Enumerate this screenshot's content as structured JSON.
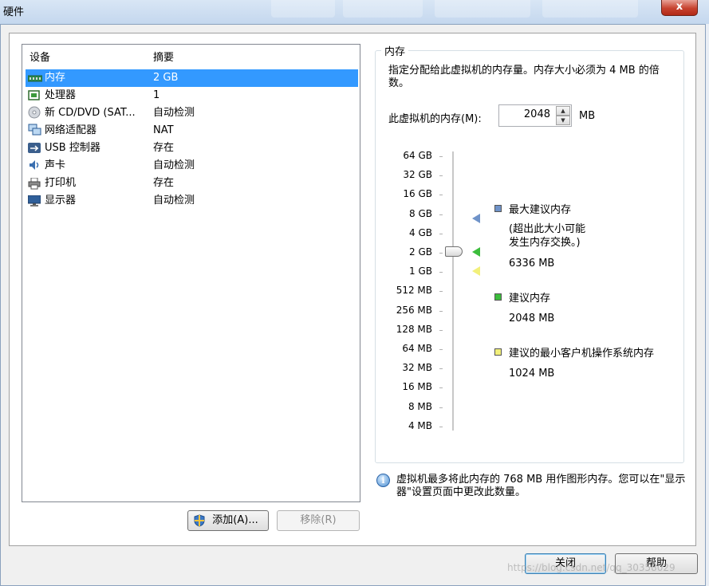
{
  "window": {
    "title": "硬件",
    "close_glyph": "x"
  },
  "devices": {
    "col_device": "设备",
    "col_summary": "摘要",
    "items": [
      {
        "name": "内存",
        "summary": "2 GB",
        "icon": "memory-icon",
        "selected": true
      },
      {
        "name": "处理器",
        "summary": "1",
        "icon": "processor-icon"
      },
      {
        "name": "新 CD/DVD (SAT...",
        "summary": "自动检测",
        "icon": "cd-dvd-icon"
      },
      {
        "name": "网络适配器",
        "summary": "NAT",
        "icon": "network-adapter-icon"
      },
      {
        "name": "USB 控制器",
        "summary": "存在",
        "icon": "usb-icon"
      },
      {
        "name": "声卡",
        "summary": "自动检测",
        "icon": "sound-card-icon"
      },
      {
        "name": "打印机",
        "summary": "存在",
        "icon": "printer-icon"
      },
      {
        "name": "显示器",
        "summary": "自动检测",
        "icon": "display-icon"
      }
    ],
    "add_button": "添加(A)...",
    "remove_button": "移除(R)"
  },
  "memory": {
    "group_title": "内存",
    "description": "指定分配给此虚拟机的内存量。内存大小必须为 4 MB 的倍数。",
    "field_label": "此虚拟机的内存(M):",
    "value": "2048",
    "unit": "MB",
    "scale": [
      "64 GB",
      "32 GB",
      "16 GB",
      "8 GB",
      "4 GB",
      "2 GB",
      "1 GB",
      "512 MB",
      "256 MB",
      "128 MB",
      "64 MB",
      "32 MB",
      "16 MB",
      "8 MB",
      "4 MB"
    ],
    "slider_value_mb": 2048,
    "legend": {
      "max": {
        "label": "最大建议内存",
        "note_line1": "(超出此大小可能",
        "note_line2": "发生内存交换。)",
        "value": "6336 MB",
        "color": "#6f93c9"
      },
      "recommended": {
        "label": "建议内存",
        "value": "2048 MB",
        "color": "#3cbd3c"
      },
      "min": {
        "label": "建议的最小客户机操作系统内存",
        "value": "1024 MB",
        "color": "#f2f07a"
      }
    },
    "info": "虚拟机最多将此内存的 768 MB 用作图形内存。您可以在\"显示器\"设置页面中更改此数量。"
  },
  "footer": {
    "close_button": "关闭",
    "help_button": "帮助"
  },
  "watermark": "https://blog.csdn.net/qq_30358029"
}
